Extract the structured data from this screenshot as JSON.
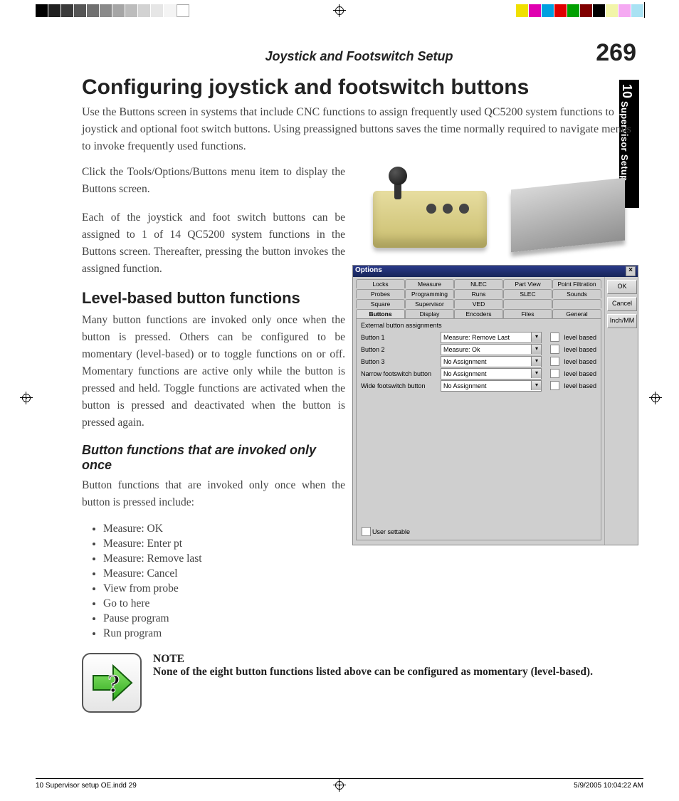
{
  "header": {
    "running_title": "Joystick and Footswitch Setup",
    "page_number": "269"
  },
  "side_tab": {
    "chapter_no": "10",
    "chapter_title": "Supervisor Setup"
  },
  "title": "Configuring joystick and footswitch buttons",
  "intro": "Use the Buttons screen in systems that include CNC functions to assign frequently used QC5200 system functions to joystick and optional foot switch buttons. Using preassigned buttons saves the time normally required to navigate menus to invoke frequently used functions.",
  "left": {
    "p1": "Click the Tools/Options/Buttons menu item to display the Buttons screen.",
    "p2": "Each of the joystick and foot switch buttons can be assigned to 1 of 14 QC5200 system functions in the Buttons screen. Thereafter, pressing the button invokes the assigned function.",
    "h2": "Level-based button functions",
    "p3": "Many button functions are invoked only once when the button is pressed. Others can be configured to be momentary (level-based) or to toggle functions on or off. Momentary functions are active only while the button is pressed and held. Toggle functions are activated when the button is pressed and deactivated when the button is pressed again.",
    "h3": "Button functions that are invoked only once",
    "p4": "Button functions that are invoked only once when the button is pressed include:",
    "bullets": [
      "Measure: OK",
      "Measure: Enter pt",
      "Measure: Remove last",
      "Measure: Cancel",
      "View from probe",
      "Go to here",
      "Pause program",
      "Run program"
    ]
  },
  "dialog": {
    "title": "Options",
    "buttons": {
      "ok": "OK",
      "cancel": "Cancel",
      "inchmm": "Inch/MM"
    },
    "tab_rows": [
      [
        "Locks",
        "Measure",
        "NLEC",
        "Part View",
        "Point Filtration"
      ],
      [
        "Probes",
        "Programming",
        "Runs",
        "SLEC",
        "Sounds"
      ],
      [
        "Square",
        "Supervisor",
        "VED",
        "",
        ""
      ],
      [
        "Buttons",
        "Display",
        "Encoders",
        "Files",
        "General"
      ]
    ],
    "active_tab": "Buttons",
    "group_label": "External button assignments",
    "rows": [
      {
        "label": "Button 1",
        "value": "Measure: Remove Last",
        "level": "level based"
      },
      {
        "label": "Button 2",
        "value": "Measure: Ok",
        "level": "level based"
      },
      {
        "label": "Button 3",
        "value": "No Assignment",
        "level": "level based"
      },
      {
        "label": "Narrow footswitch button",
        "value": "No Assignment",
        "level": "level based"
      },
      {
        "label": "Wide footswitch button",
        "value": "No Assignment",
        "level": "level based"
      }
    ],
    "user_settable": "User settable"
  },
  "note": {
    "title": "NOTE",
    "body": "None of the eight button functions listed above can be configured as momentary (level-based)."
  },
  "footer": {
    "left": "10 Supervisor setup OE.indd   29",
    "right": "5/9/2005   10:04:22 AM"
  }
}
